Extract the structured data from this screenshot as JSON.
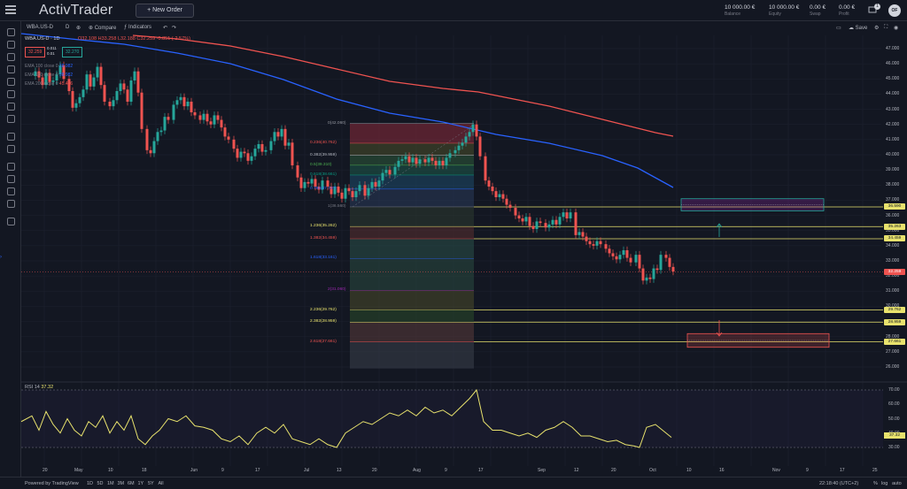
{
  "app": {
    "logo": "ActivTrader",
    "new_order": "+ New Order",
    "stats": [
      {
        "value": "10 000.00 €",
        "label": "Balance"
      },
      {
        "value": "10 000.00 €",
        "label": "Equity"
      },
      {
        "value": "0.00 €",
        "label": "Swap"
      },
      {
        "value": "0.00 €",
        "label": "Profit"
      }
    ],
    "notification_count": "1",
    "avatar": "OF"
  },
  "toolbar": {
    "symbol": "WBA.US-D",
    "interval": "D",
    "compare": "Compare",
    "indicators": "Indicators",
    "save": "Save"
  },
  "legend": {
    "symbol": "WBA.US-D · 1D",
    "ohlc": "O32.108 H33.258 L32.188 C32.259 -0.851 (-2.57%)",
    "bid": "32.259",
    "spread_top": "0.011",
    "spread_bottom": "0.01",
    "ask": "32.270",
    "emas": [
      {
        "text": "EMA 100 close 0",
        "value": "38.982"
      },
      {
        "text": "EMA 100 close 0",
        "value": "38.982"
      },
      {
        "text": "EMA 200 close 0",
        "value": "45.436"
      }
    ]
  },
  "price_axis": [
    "47.000",
    "46.000",
    "45.000",
    "44.000",
    "43.000",
    "42.000",
    "41.000",
    "40.000",
    "39.000",
    "38.000",
    "37.000",
    "36.000",
    "35.000",
    "34.000",
    "33.000",
    "32.000",
    "31.000",
    "30.000",
    "29.000",
    "28.000",
    "27.000",
    "26.000"
  ],
  "axis_tags": [
    {
      "text": "36.590",
      "kind": "yellow"
    },
    {
      "text": "35.263",
      "kind": "yellow"
    },
    {
      "text": "34.459",
      "kind": "yellow"
    },
    {
      "text": "32.259",
      "kind": "red"
    },
    {
      "text": "29.762",
      "kind": "yellow"
    },
    {
      "text": "28.959",
      "kind": "yellow"
    },
    {
      "text": "27.661",
      "kind": "yellow"
    }
  ],
  "fib_levels": [
    {
      "text": "0(42.060)",
      "color": "#9598a1"
    },
    {
      "text": "0.236(40.762)",
      "color": "#ef5350"
    },
    {
      "text": "0.382(39.959)",
      "color": "#b2b5be"
    },
    {
      "text": "0.5(39.310)",
      "color": "#4caf50"
    },
    {
      "text": "0.618(38.661)",
      "color": "#089981"
    },
    {
      "text": "0.786(37.737)",
      "color": "#2962ff"
    },
    {
      "text": "1(36.560)",
      "color": "#787b86"
    },
    {
      "text": "1.236(35.262)",
      "color": "#e8e26d"
    },
    {
      "text": "1.382(34.459)",
      "color": "#ef5350"
    },
    {
      "text": "1.618(33.161)",
      "color": "#2962ff"
    },
    {
      "text": "2(31.060)",
      "color": "#9c27b0"
    },
    {
      "text": "2.236(29.762)",
      "color": "#e8e26d"
    },
    {
      "text": "2.382(28.959)",
      "color": "#e8e26d"
    },
    {
      "text": "2.618(27.661)",
      "color": "#ef5350"
    }
  ],
  "rsi": {
    "title": "RSI 14",
    "value": "37.32",
    "axis": [
      "70.00",
      "60.00",
      "50.00",
      "40.00",
      "30.00"
    ],
    "tag": "37.32"
  },
  "time_axis": [
    "20",
    "May",
    "10",
    "18",
    "Jun",
    "9",
    "17",
    "Jul",
    "13",
    "20",
    "Aug",
    "9",
    "17",
    "Sep",
    "12",
    "20",
    "Oct",
    "10",
    "16",
    "Nov",
    "9",
    "17",
    "25"
  ],
  "bottom_bar": {
    "powered": "Powered by TradingView",
    "ranges": [
      "1D",
      "5D",
      "1M",
      "3M",
      "6M",
      "1Y",
      "5Y",
      "All"
    ],
    "clock": "22:18:40 (UTC+2)",
    "options": [
      "%",
      "log",
      "auto"
    ]
  },
  "colors": {
    "up": "#26a69a",
    "down": "#ef5350",
    "ema100": "#2962ff",
    "ema200": "#ef5350",
    "rsi": "#e8e26d",
    "fib_yellow": "#e8e26d"
  }
}
